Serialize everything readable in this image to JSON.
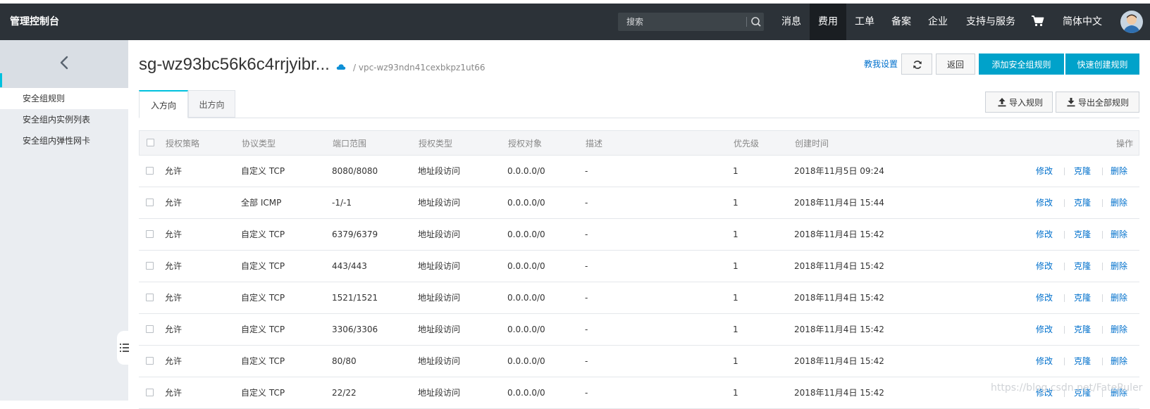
{
  "topbar": {
    "brand": "管理控制台",
    "search_placeholder": "搜索",
    "nav": [
      "消息",
      "费用",
      "工单",
      "备案",
      "企业",
      "支持与服务"
    ],
    "active_nav": "费用",
    "language": "简体中文",
    "accent_color": "#00c1de"
  },
  "sidebar": {
    "items": [
      {
        "label": "安全组规则"
      },
      {
        "label": "安全组内实例列表"
      },
      {
        "label": "安全组内弹性网卡"
      }
    ]
  },
  "header": {
    "title": "sg-wz93bc56k6c4rrjyibr...",
    "vpc": "/ vpc-wz93ndn41cexbkpz1ut66",
    "help_link": "教我设置",
    "back_button": "返回",
    "add_rule_button": "添加安全组规则",
    "quick_create_button": "快速创建规则"
  },
  "tabs": {
    "inbound": "入方向",
    "outbound": "出方向"
  },
  "toolbar": {
    "import_button": "导入规则",
    "export_button": "导出全部规则"
  },
  "table": {
    "columns": [
      "授权策略",
      "协议类型",
      "端口范围",
      "授权类型",
      "授权对象",
      "描述",
      "优先级",
      "创建时间",
      "操作"
    ],
    "actions": [
      "修改",
      "克隆",
      "删除"
    ],
    "rows": [
      {
        "policy": "允许",
        "protocol": "自定义 TCP",
        "ports": "8080/8080",
        "auth_type": "地址段访问",
        "target": "0.0.0.0/0",
        "desc": "-",
        "priority": "1",
        "created": "2018年11月5日 09:24"
      },
      {
        "policy": "允许",
        "protocol": "全部 ICMP",
        "ports": "-1/-1",
        "auth_type": "地址段访问",
        "target": "0.0.0.0/0",
        "desc": "-",
        "priority": "1",
        "created": "2018年11月4日 15:44"
      },
      {
        "policy": "允许",
        "protocol": "自定义 TCP",
        "ports": "6379/6379",
        "auth_type": "地址段访问",
        "target": "0.0.0.0/0",
        "desc": "-",
        "priority": "1",
        "created": "2018年11月4日 15:42"
      },
      {
        "policy": "允许",
        "protocol": "自定义 TCP",
        "ports": "443/443",
        "auth_type": "地址段访问",
        "target": "0.0.0.0/0",
        "desc": "-",
        "priority": "1",
        "created": "2018年11月4日 15:42"
      },
      {
        "policy": "允许",
        "protocol": "自定义 TCP",
        "ports": "1521/1521",
        "auth_type": "地址段访问",
        "target": "0.0.0.0/0",
        "desc": "-",
        "priority": "1",
        "created": "2018年11月4日 15:42"
      },
      {
        "policy": "允许",
        "protocol": "自定义 TCP",
        "ports": "3306/3306",
        "auth_type": "地址段访问",
        "target": "0.0.0.0/0",
        "desc": "-",
        "priority": "1",
        "created": "2018年11月4日 15:42"
      },
      {
        "policy": "允许",
        "protocol": "自定义 TCP",
        "ports": "80/80",
        "auth_type": "地址段访问",
        "target": "0.0.0.0/0",
        "desc": "-",
        "priority": "1",
        "created": "2018年11月4日 15:42"
      },
      {
        "policy": "允许",
        "protocol": "自定义 TCP",
        "ports": "22/22",
        "auth_type": "地址段访问",
        "target": "0.0.0.0/0",
        "desc": "-",
        "priority": "1",
        "created": "2018年11月4日 15:42"
      }
    ]
  },
  "watermark": "https://blog.csdn.net/FateRuler"
}
